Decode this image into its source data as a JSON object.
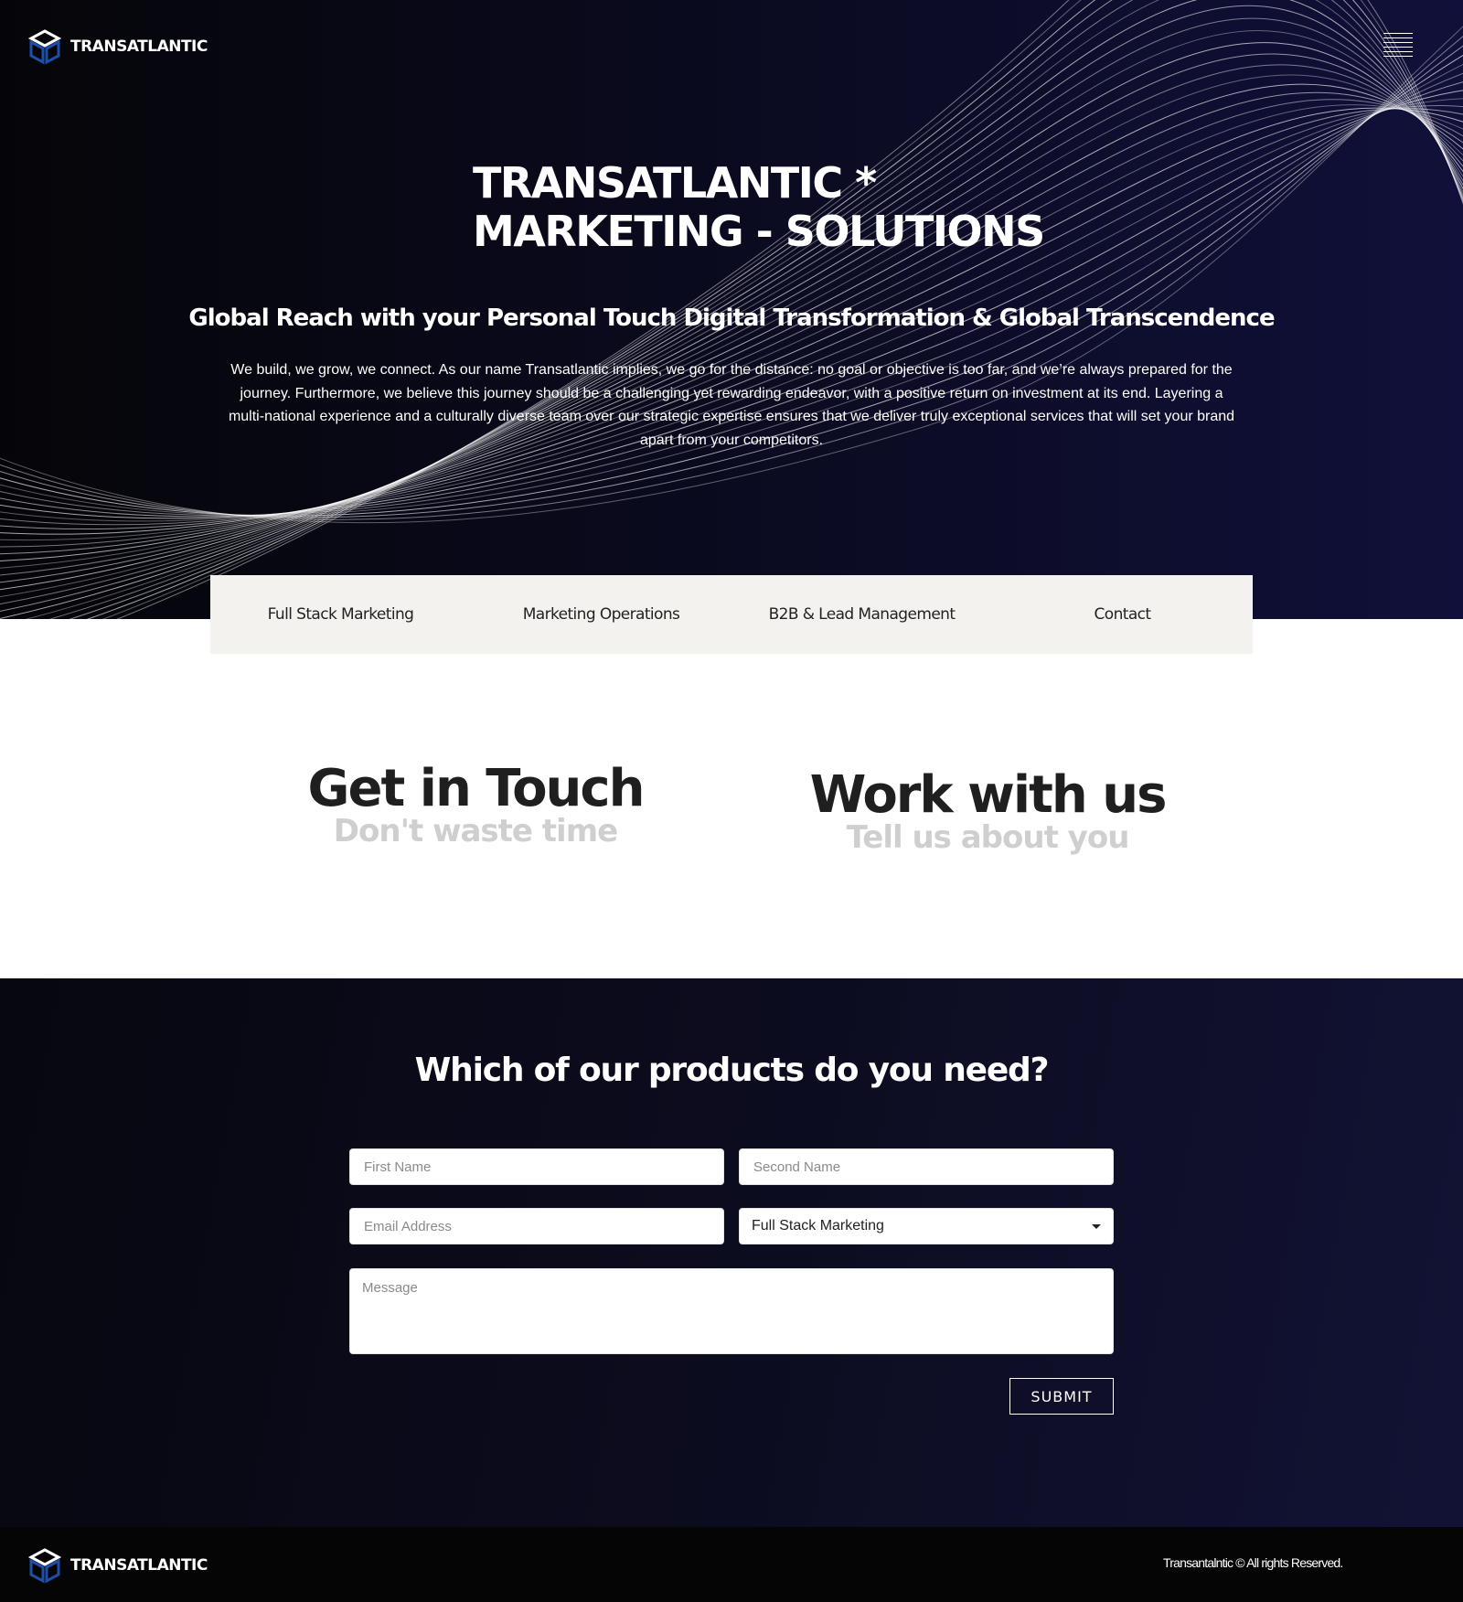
{
  "brand": {
    "name": "TRANSATLANTIC",
    "logo_icon": "cube-logo-icon"
  },
  "header": {
    "menu_icon": "hamburger-menu-icon"
  },
  "hero": {
    "title_line1": "TRANSATLANTIC *",
    "title_line2": "MARKETING - SOLUTIONS",
    "subtitle": "Global Reach with your Personal Touch Digital Transformation & Global Transcendence",
    "description": "We build, we grow, we connect. As our name Transatlantic implies, we go for the distance: no goal or objective is too far, and we’re always prepared for the journey. Furthermore, we believe this journey should be a challenging yet rewarding endeavor, with a positive return on investment at its end. Layering a multi-national experience and a culturally diverse team over our strategic expertise ensures that we deliver truly exceptional services that will set your brand apart from your competitors."
  },
  "nav": {
    "items": [
      {
        "label": "Full Stack Marketing"
      },
      {
        "label": "Marketing Operations"
      },
      {
        "label": "B2B & Lead Management"
      },
      {
        "label": "Contact"
      }
    ]
  },
  "touch": {
    "left_title": "Get in Touch",
    "left_subtitle": "Don't waste time",
    "right_title": "Work with us",
    "right_subtitle": "Tell us about you"
  },
  "form": {
    "title": "Which of our products do you need?",
    "first_name_placeholder": "First Name",
    "second_name_placeholder": "Second Name",
    "email_placeholder": "Email Address",
    "product_selected": "Full Stack Marketing",
    "message_placeholder": "Message",
    "submit_label": "SUBMIT"
  },
  "footer": {
    "copyright": "Transantalntic © All rights Reserved."
  },
  "colors": {
    "hero_bg": "#0b0b22",
    "nav_bg": "#f3f2ef",
    "heading_dark": "#1f1f1f",
    "subheading_gray": "#cfcfcf",
    "footer_bg": "#050505"
  }
}
